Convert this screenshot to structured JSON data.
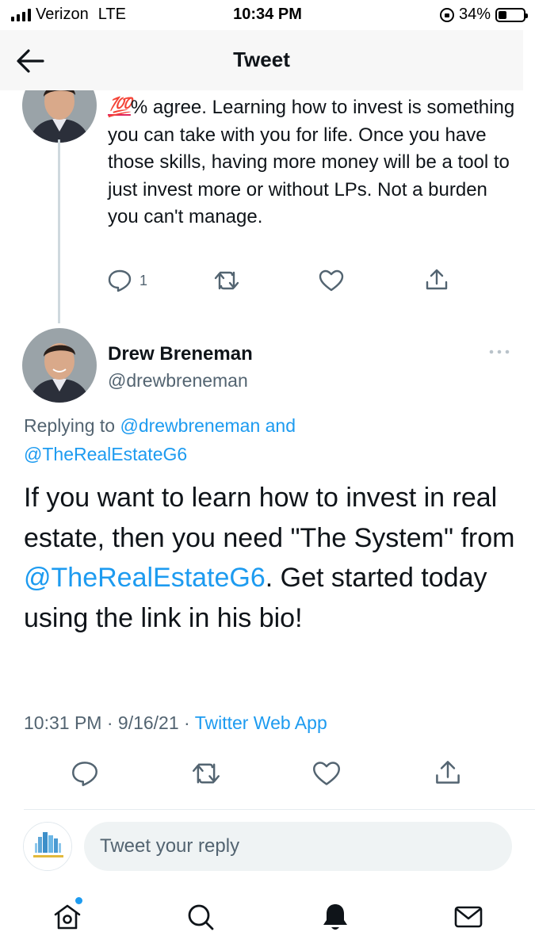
{
  "status_bar": {
    "carrier": "Verizon",
    "network": "LTE",
    "time": "10:34 PM",
    "battery": "34%",
    "battery_level": 0.34
  },
  "header": {
    "title": "Tweet",
    "back_icon": "arrow-left-icon"
  },
  "previous_tweet": {
    "emoji": "💯",
    "text": "% agree. Learning how to invest is something you can take with you for life. Once you have those skills, having more money will be a tool to just invest more or without LPs. Not a burden you can't manage.",
    "reply_count": "1"
  },
  "main_tweet": {
    "author_name": "Drew Breneman",
    "author_handle": "@drewbreneman",
    "replying_prefix": "Replying to",
    "replying_user1": "@drewbreneman",
    "replying_and": "and",
    "replying_user2": "@TheRealEstateG6",
    "text_part1": "If you want to learn how to invest in real estate, then you need \"The System\" from",
    "text_mention": "@TheRealEstateG6",
    "text_part2": ". Get started today using the link in his bio!",
    "time": "10:31 PM",
    "date": "9/16/21",
    "source": "Twitter Web App"
  },
  "reply_composer": {
    "placeholder": "Tweet your reply"
  },
  "accent_color": "#1d9bf0"
}
